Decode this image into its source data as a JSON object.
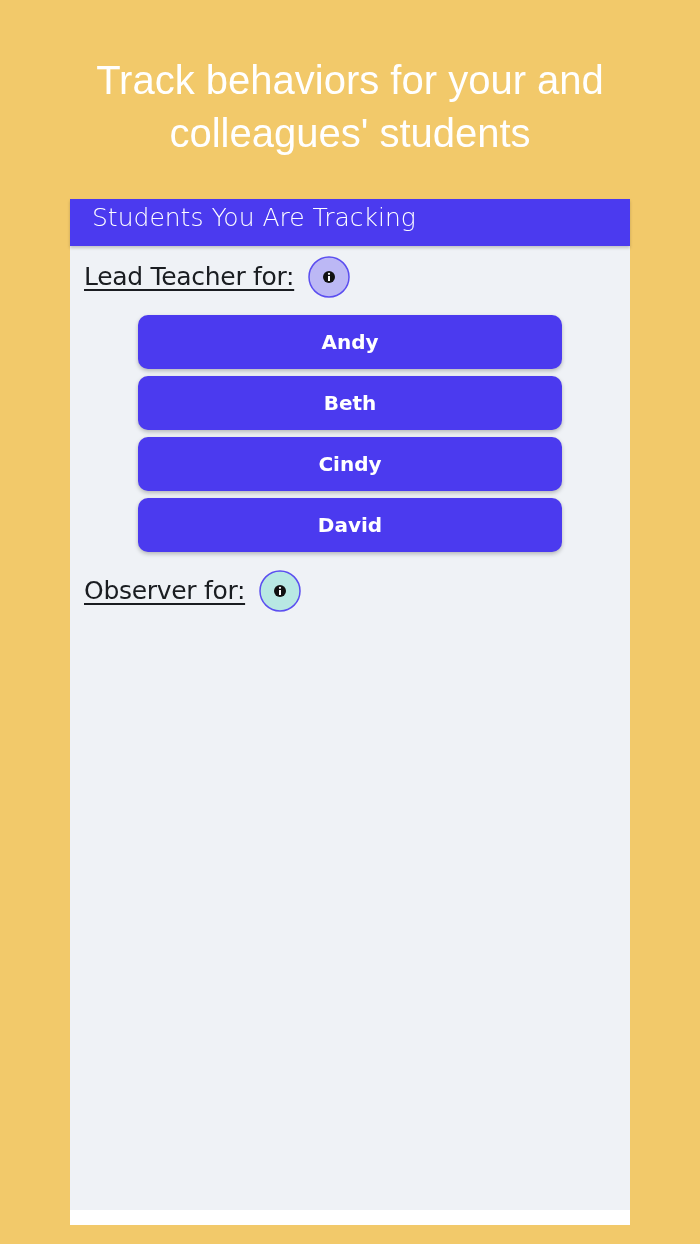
{
  "headline": "Track behaviors for your and colleagues' students",
  "screen": {
    "title": "Students You Are Tracking",
    "sections": [
      {
        "heading": "Lead Teacher for:",
        "color": "#bcb8f5",
        "students": [
          "Andy",
          "Beth",
          "Cindy",
          "David"
        ]
      },
      {
        "heading": "Observer for:",
        "color": "#b8e8e3"
      }
    ]
  }
}
